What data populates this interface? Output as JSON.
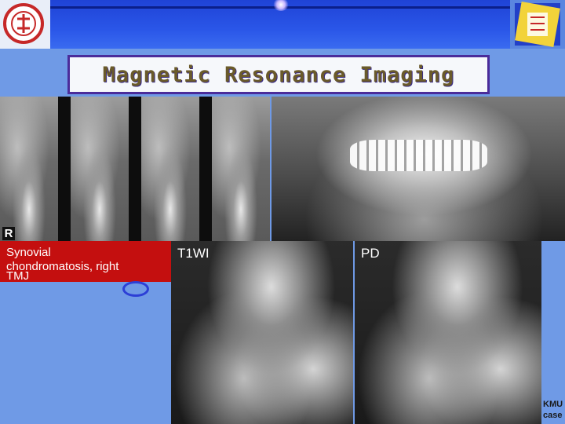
{
  "title": "Magnetic Resonance Imaging",
  "xray": {
    "side_marker": "R"
  },
  "caption": {
    "line1": "Synovial",
    "line2": "chondromatosis, right",
    "line3": "TMJ"
  },
  "mri_panels": [
    {
      "label": "T1WI"
    },
    {
      "label": "PD"
    }
  ],
  "credit": {
    "line1": "KMU",
    "line2": "case"
  },
  "colors": {
    "background": "#6f9ae6",
    "banner": "#2a56e8",
    "caption_bg": "#c40f0f",
    "title_border": "#4b2c9a"
  }
}
